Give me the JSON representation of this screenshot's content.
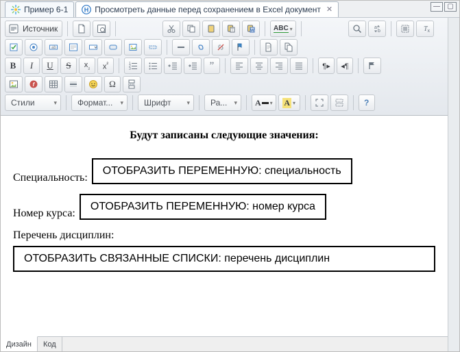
{
  "tabs": {
    "items": [
      {
        "label": "Пример 6-1",
        "active": false
      },
      {
        "label": "Просмотреть данные перед сохранением в Excel документ",
        "active": true
      }
    ]
  },
  "toolbar": {
    "source_label": "Источник",
    "styles_label": "Стили",
    "format_label": "Формат...",
    "font_label": "Шрифт",
    "size_label": "Ра..."
  },
  "document": {
    "heading": "Будут записаны следующие значения:",
    "rows": [
      {
        "label": "Специальность:",
        "box": "ОТОБРАЗИТЬ ПЕРЕМЕННУЮ: специальность"
      },
      {
        "label": "Номер курса:",
        "box": "ОТОБРАЗИТЬ ПЕРЕМЕННУЮ: номер курса"
      },
      {
        "label": "Перечень дисциплин:",
        "box": "ОТОБРАЗИТЬ СВЯЗАННЫЕ СПИСКИ: перечень дисциплин",
        "wide": true
      }
    ]
  },
  "bottom_tabs": {
    "design": "Дизайн",
    "code": "Код"
  },
  "icons": {
    "spark": "✶",
    "h": "H",
    "close": "✕",
    "newpage": "▫",
    "preview": "▤",
    "cut": "✂",
    "copy1": "⧉",
    "copy2": "⧉",
    "copy3": "⧉",
    "paste": "📋",
    "word": "📄",
    "abc": "ABC",
    "search": "🔍",
    "replace": "↯",
    "selectall": "☰",
    "clearfmt": "Tₓ",
    "check": "☑",
    "radio": "◉",
    "text": "ab",
    "textarea": "▭",
    "select": "▾",
    "button": "▭",
    "image": "🖼",
    "hidden": "—",
    "minus": "—",
    "link": "🔗",
    "unlink": "⊘",
    "anchor": "⚑",
    "file1": "📄",
    "file2": "📄",
    "bold": "B",
    "italic": "I",
    "underline": "U",
    "strike": "S",
    "sub": "x₂",
    "sup": "x²",
    "numlist": "≣",
    "bullist": "•≣",
    "outdent": "⇤",
    "indent": "⇥",
    "quote": "❝",
    "alignl": "≡",
    "alignc": "≡",
    "alignr": "≡",
    "alignj": "≡",
    "ltr": "¶▸",
    "rtl": "◂¶",
    "flag": "⚑",
    "imgins": "🖼",
    "flash": "Ⓕ",
    "table": "▦",
    "hr": "—",
    "smile": "☺",
    "omega": "Ω",
    "pagebreak": "⤓",
    "textcolor": "A",
    "bgcolor": "A",
    "maximize": "⛶",
    "blocks": "▥",
    "help": "?",
    "carets": "▾"
  }
}
